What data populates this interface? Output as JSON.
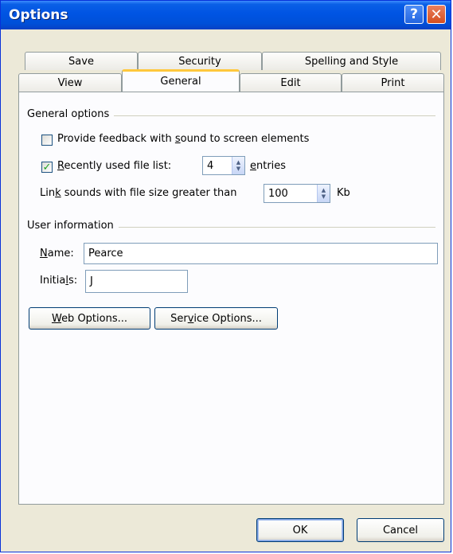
{
  "window": {
    "title": "Options",
    "help_glyph": "?",
    "close_glyph": "✕"
  },
  "tabs": {
    "row1": [
      "Save",
      "Security",
      "Spelling and Style"
    ],
    "row2": [
      "View",
      "General",
      "Edit",
      "Print"
    ],
    "active": "General"
  },
  "general_options": {
    "group_label": "General options",
    "feedback_sound": {
      "label_pre": "Provide feedback with ",
      "label_access": "s",
      "label_post": "ound to screen elements",
      "checked": false
    },
    "recent_files": {
      "label_access": "R",
      "label_post": "ecently used file list:",
      "checked": true,
      "value": "4",
      "suffix_access": "e",
      "suffix_post": "ntries"
    },
    "link_sounds": {
      "label_pre": "Lin",
      "label_access": "k",
      "label_post": " sounds with file size greater than",
      "value": "100",
      "unit": "Kb"
    }
  },
  "user_information": {
    "group_label": "User information",
    "name": {
      "label_access": "N",
      "label_post": "ame:",
      "value": "Pearce"
    },
    "initials": {
      "label_pre": "Initia",
      "label_access": "l",
      "label_post": "s:",
      "value": "J"
    }
  },
  "buttons": {
    "web_options": {
      "access": "W",
      "rest": "eb Options..."
    },
    "service_options": {
      "pre": "Ser",
      "access": "v",
      "rest": "ice Options..."
    },
    "ok": "OK",
    "cancel": "Cancel"
  },
  "colors": {
    "titlebar": "#0054E3",
    "dialog_bg": "#ECE9D8",
    "active_tab_accent": "#FFC83C",
    "check_mark": "#21A121"
  }
}
